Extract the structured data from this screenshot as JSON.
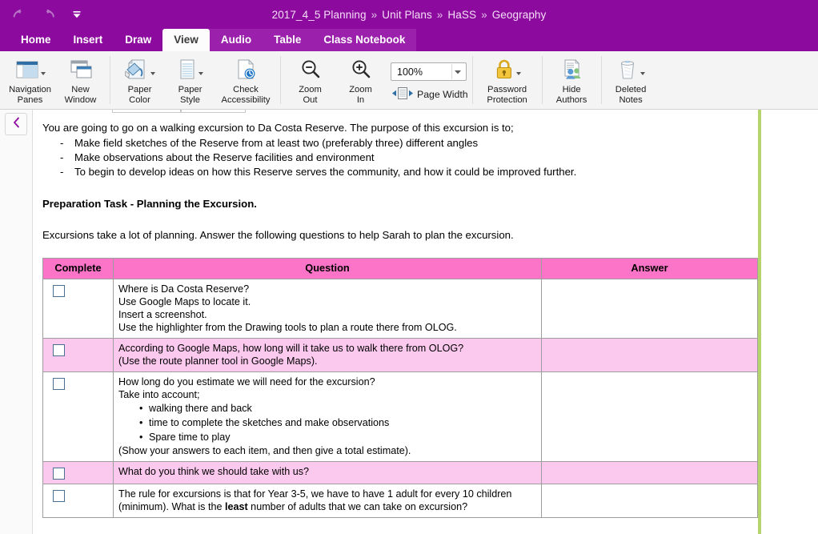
{
  "titlebar": {
    "undo_label": "Undo",
    "redo_label": "Redo",
    "customize_label": "Customize Quick Access Toolbar",
    "breadcrumb": [
      "2017_4_5 Planning",
      "Unit Plans",
      "HaSS",
      "Geography"
    ],
    "separator": "»",
    "accent_color": "#8d0a9e"
  },
  "tabs": [
    {
      "label": "Home",
      "active": false,
      "contextual": false
    },
    {
      "label": "Insert",
      "active": false,
      "contextual": false
    },
    {
      "label": "Draw",
      "active": false,
      "contextual": false
    },
    {
      "label": "View",
      "active": true,
      "contextual": false
    },
    {
      "label": "Audio",
      "active": false,
      "contextual": true
    },
    {
      "label": "Table",
      "active": false,
      "contextual": true
    },
    {
      "label": "Class Notebook",
      "active": false,
      "contextual": true
    }
  ],
  "ribbon": {
    "buttons": [
      {
        "id": "navigation-panes",
        "label": "Navigation\nPanes",
        "icon": "panes-icon",
        "has_caret": true
      },
      {
        "id": "new-window",
        "label": "New\nWindow",
        "icon": "new-window-icon",
        "has_caret": false
      },
      {
        "id": "paper-color",
        "label": "Paper\nColor",
        "icon": "paint-bucket-icon",
        "has_caret": true
      },
      {
        "id": "paper-style",
        "label": "Paper\nStyle",
        "icon": "ruled-page-icon",
        "has_caret": true
      },
      {
        "id": "check-accessibility",
        "label": "Check\nAccessibility",
        "icon": "accessibility-icon",
        "has_caret": false
      },
      {
        "id": "zoom-out",
        "label": "Zoom\nOut",
        "icon": "zoom-out-icon",
        "has_caret": false
      },
      {
        "id": "zoom-in",
        "label": "Zoom\nIn",
        "icon": "zoom-in-icon",
        "has_caret": false
      },
      {
        "id": "password-protection",
        "label": "Password\nProtection",
        "icon": "lock-icon",
        "has_caret": true
      },
      {
        "id": "hide-authors",
        "label": "Hide\nAuthors",
        "icon": "authors-icon",
        "has_caret": false
      },
      {
        "id": "deleted-notes",
        "label": "Deleted\nNotes",
        "icon": "trash-icon",
        "has_caret": true
      }
    ],
    "zoom_value": "100%",
    "page_width_label": "Page Width"
  },
  "navrail": {
    "collapse_label": "Collapse navigation",
    "collapse_icon": "chevron-left-icon"
  },
  "page": {
    "intro": "You are going to go on a walking excursion to Da Costa Reserve.  The purpose of this excursion is to;",
    "bullets": [
      "Make field sketches of the Reserve from at least two (preferably three) different angles",
      "Make observations about the Reserve facilities  and environment",
      "To begin to develop ideas on how this Reserve serves the community, and how it could be improved further."
    ],
    "heading": "Preparation Task - Planning the Excursion.",
    "lead_in": "Excursions take a lot of planning.  Answer the following questions to help Sarah to plan the excursion.",
    "table": {
      "headers": [
        "Complete",
        "Question",
        "Answer"
      ],
      "header_bg": "#fb74c8",
      "tint_bg": "#fcc9ee",
      "rows": [
        {
          "tinted": false,
          "checkbox": false,
          "lines": [
            "Where is Da Costa Reserve?",
            "Use Google Maps to locate it.",
            "Insert a screenshot.",
            "Use the highlighter from the Drawing tools to plan a route there from OLOG."
          ],
          "sub_bullets": [],
          "trailing": "",
          "answer": ""
        },
        {
          "tinted": true,
          "checkbox": false,
          "lines": [
            "According to Google Maps, how long will it take us to walk there from OLOG?",
            "(Use the route planner tool in Google Maps)."
          ],
          "sub_bullets": [],
          "trailing": "",
          "answer": ""
        },
        {
          "tinted": false,
          "checkbox": false,
          "lines": [
            "How long do you estimate we will need for the excursion?",
            "Take into account;"
          ],
          "sub_bullets": [
            "walking there and back",
            "time to complete the sketches and make observations",
            "Spare time to play"
          ],
          "trailing": "(Show your answers to each item, and then give a total estimate).",
          "answer": ""
        },
        {
          "tinted": true,
          "checkbox": false,
          "lines": [
            "What do you think we should take with us?"
          ],
          "sub_bullets": [],
          "trailing": "",
          "answer": ""
        },
        {
          "tinted": false,
          "checkbox": false,
          "lines": [],
          "rich": [
            {
              "text": "The rule for excursions is that for Year 3-5, we have to have 1 adult for every 10 children",
              "bold_part": ""
            },
            {
              "text": "(minimum).  What is the ",
              "bold_part": "least",
              "text_after": " number of adults that we can take on excursion?"
            }
          ],
          "sub_bullets": [],
          "trailing": "",
          "answer": ""
        }
      ]
    },
    "page_edge_color": "#b5d46c"
  }
}
